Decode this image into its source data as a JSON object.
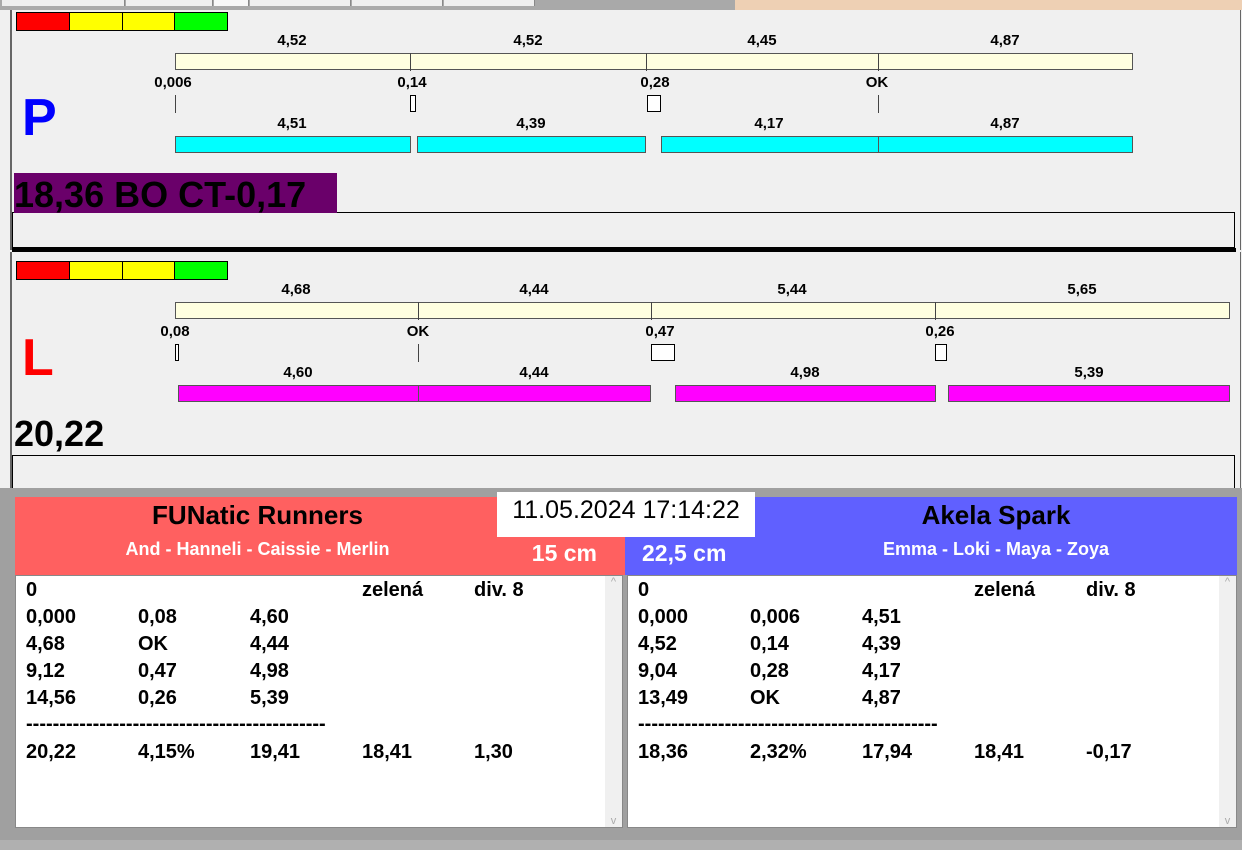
{
  "p": {
    "letter": "P",
    "status": "18,36 BO CT-0,17",
    "top_values": [
      "4,52",
      "4,52",
      "4,45",
      "4,87"
    ],
    "markers": [
      "0,006",
      "0,14",
      "0,28",
      "OK"
    ],
    "bottom_values": [
      "4,51",
      "4,39",
      "4,17",
      "4,87"
    ]
  },
  "l": {
    "letter": "L",
    "status": "20,22",
    "top_values": [
      "4,68",
      "4,44",
      "5,44",
      "5,65"
    ],
    "markers": [
      "0,08",
      "OK",
      "0,47",
      "0,26"
    ],
    "bottom_values": [
      "4,60",
      "4,44",
      "4,98",
      "5,39"
    ]
  },
  "datetime": "11.05.2024 17:14:22",
  "left_team": {
    "name": "FUNatic Runners",
    "members": "And - Hanneli - Caissie - Merlin",
    "distance": "15 cm",
    "rows": [
      [
        "0",
        "",
        "",
        "zelená",
        "div. 8"
      ],
      [
        "0,000",
        "0,08",
        "4,60"
      ],
      [
        "4,68",
        "OK",
        "4,44"
      ],
      [
        "9,12",
        "0,47",
        "4,98"
      ],
      [
        "14,56",
        "0,26",
        "5,39"
      ]
    ],
    "separator": "---------------------------------------------",
    "total": [
      "20,22",
      "4,15%",
      "19,41",
      "18,41",
      "1,30"
    ]
  },
  "right_team": {
    "name": "Akela Spark",
    "members": "Emma - Loki - Maya - Zoya",
    "distance": "22,5 cm",
    "rows": [
      [
        "0",
        "",
        "",
        "zelená",
        "div. 8"
      ],
      [
        "0,000",
        "0,006",
        "4,51"
      ],
      [
        "4,52",
        "0,14",
        "4,39"
      ],
      [
        "9,04",
        "0,28",
        "4,17"
      ],
      [
        "13,49",
        "OK",
        "4,87"
      ]
    ],
    "separator": "---------------------------------------------",
    "total": [
      "18,36",
      "2,32%",
      "17,94",
      "18,41",
      "-0,17"
    ]
  },
  "colors": {
    "red": "#ff6060",
    "blue": "#6060ff",
    "cyan": "#00ffff",
    "magenta": "#ff00ff",
    "beige": "#ffffe0",
    "purple": "#6a006a"
  }
}
